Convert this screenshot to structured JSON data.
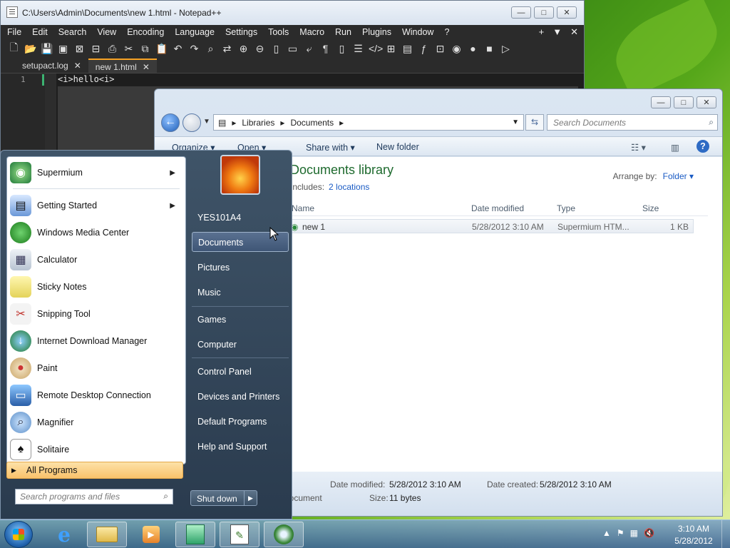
{
  "notepad": {
    "title": "C:\\Users\\Admin\\Documents\\new 1.html - Notepad++",
    "menu": [
      "File",
      "Edit",
      "Search",
      "View",
      "Encoding",
      "Language",
      "Settings",
      "Tools",
      "Macro",
      "Run",
      "Plugins",
      "Window",
      "?"
    ],
    "menu_right": [
      "+",
      "▼",
      "✕"
    ],
    "tabs": [
      {
        "label": "setupact.log"
      },
      {
        "label": "new 1.html"
      }
    ],
    "line_number": "1",
    "code": "<i>hello<i>"
  },
  "explorer": {
    "breadcrumb": [
      "Libraries",
      "Documents"
    ],
    "search_placeholder": "Search Documents",
    "commands": {
      "organize": "Organize ▾",
      "open": "Open ▾",
      "share": "Share with ▾",
      "new_folder": "New folder"
    },
    "library_title": "Documents library",
    "includes_label": "Includes:",
    "includes_link": "2 locations",
    "arrange_label": "Arrange by:",
    "arrange_value": "Folder ▾",
    "columns": {
      "name": "Name",
      "date": "Date modified",
      "type": "Type",
      "size": "Size"
    },
    "file": {
      "name": "new 1",
      "date": "5/28/2012 3:10 AM",
      "type": "Supermium HTM...",
      "size": "1 KB"
    },
    "details": {
      "date_modified_label": "Date modified:",
      "date_modified": "5/28/2012 3:10 AM",
      "date_created_label": "Date created:",
      "date_created": "5/28/2012 3:10 AM",
      "type": "Document",
      "size_label": "Size:",
      "size": "11 bytes"
    }
  },
  "start_menu": {
    "programs": [
      {
        "label": "Supermium",
        "icon": "supermium-icon",
        "arrow": true
      },
      {
        "label": "Getting Started",
        "icon": "getting-started-icon",
        "arrow": true
      },
      {
        "label": "Windows Media Center",
        "icon": "media-center-icon"
      },
      {
        "label": "Calculator",
        "icon": "calculator-icon"
      },
      {
        "label": "Sticky Notes",
        "icon": "sticky-notes-icon"
      },
      {
        "label": "Snipping Tool",
        "icon": "snipping-tool-icon"
      },
      {
        "label": "Internet Download Manager",
        "icon": "idm-icon"
      },
      {
        "label": "Paint",
        "icon": "paint-icon"
      },
      {
        "label": "Remote Desktop Connection",
        "icon": "remote-desktop-icon"
      },
      {
        "label": "Magnifier",
        "icon": "magnifier-icon"
      },
      {
        "label": "Solitaire",
        "icon": "solitaire-icon"
      }
    ],
    "all_programs": "All Programs",
    "search_placeholder": "Search programs and files",
    "user": "YES101A4",
    "right_items": [
      "Documents",
      "Pictures",
      "Music",
      "Games",
      "Computer",
      "Control Panel",
      "Devices and Printers",
      "Default Programs",
      "Help and Support"
    ],
    "shutdown": "Shut down"
  },
  "taskbar": {
    "time": "3:10 AM",
    "date": "5/28/2012"
  }
}
